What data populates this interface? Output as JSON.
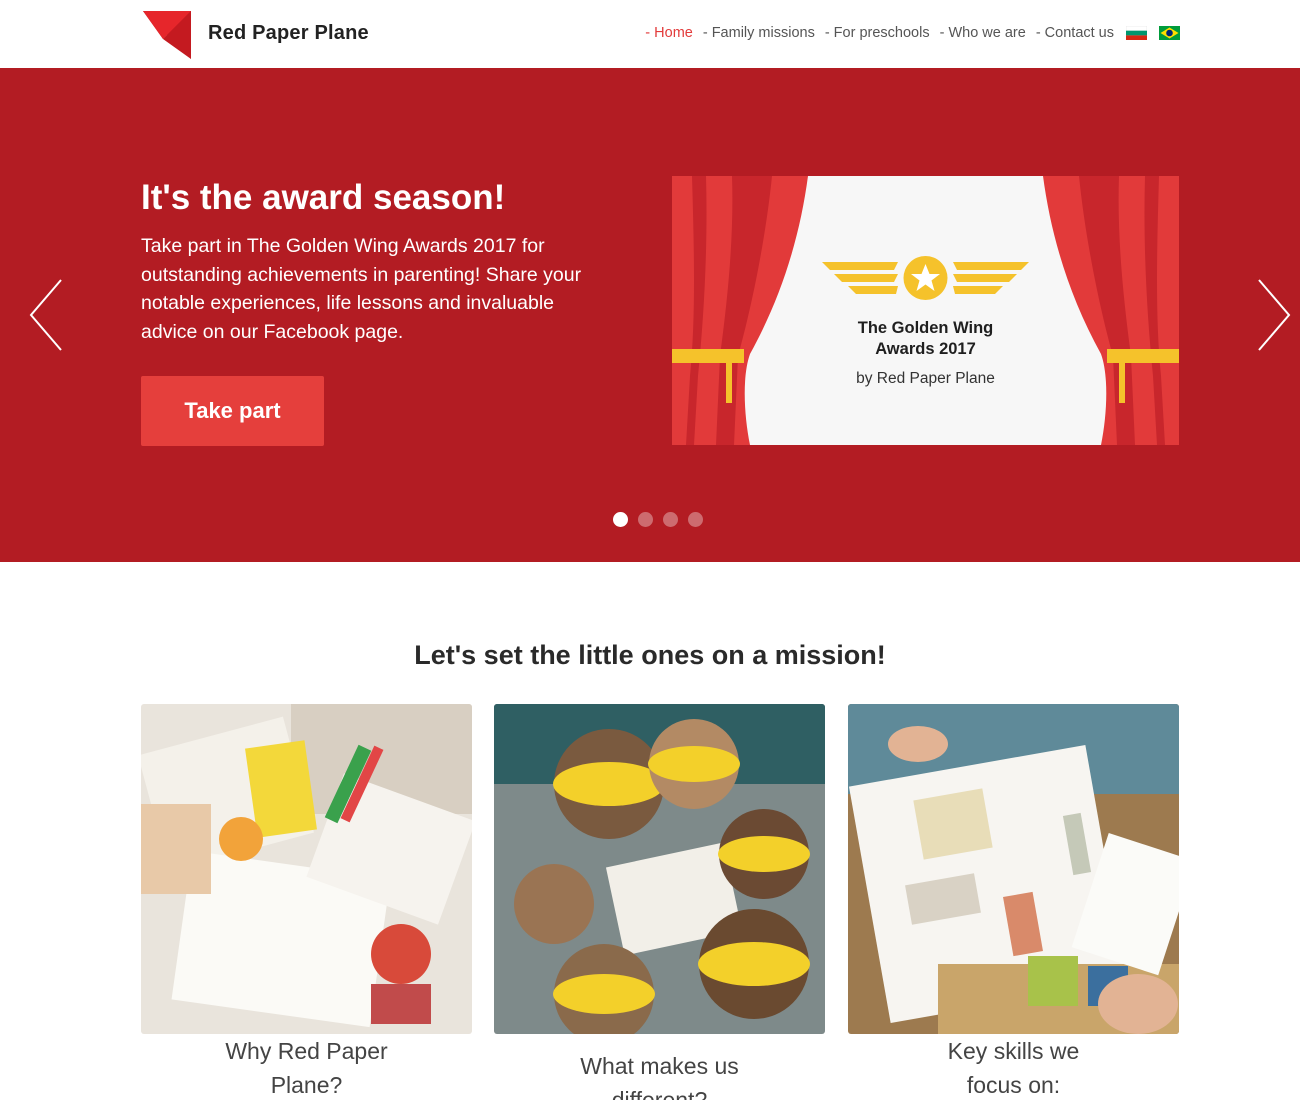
{
  "header": {
    "brand": "Red Paper Plane",
    "nav": [
      {
        "label": "- Home",
        "active": true
      },
      {
        "label": "- Family missions"
      },
      {
        "label": "- For preschools"
      },
      {
        "label": "- Who we are"
      },
      {
        "label": "- Contact us"
      }
    ],
    "flags": [
      "bulgaria-flag-icon",
      "brazil-flag-icon"
    ]
  },
  "hero": {
    "title": "It's the award season!",
    "text": "Take part in The Golden Wing Awards 2017 for outstanding achievements in parenting! Share your notable experiences, life lessons and invaluable advice on our Facebook page.",
    "button": "Take part",
    "slide_image": {
      "title_line1": "The Golden Wing",
      "title_line2": "Awards 2017",
      "by": "by Red Paper Plane"
    },
    "dots": 4,
    "active_dot": 1
  },
  "missions": {
    "title": "Let's set the little ones on a mission!",
    "cards": [
      {
        "line1": "Why Red Paper",
        "line2": "Plane?"
      },
      {
        "line1": "What makes us",
        "line2": "different?"
      },
      {
        "line1": "Key skills we",
        "line2": "focus on:"
      }
    ]
  },
  "colors": {
    "hero_bg": "#b31c23",
    "accent": "#e53f3c",
    "nav_active": "#e23b3b"
  }
}
